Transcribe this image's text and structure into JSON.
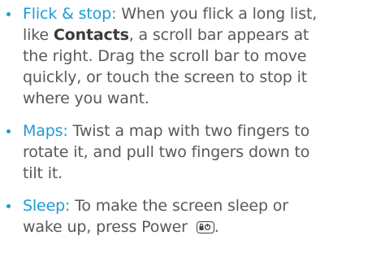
{
  "colors": {
    "accent": "#1e9ad6",
    "body_text": "#595959",
    "bold_text": "#3a3a3a"
  },
  "items": [
    {
      "term": "Flick & stop:",
      "line1_text": " When you flick a long list,",
      "line2_prefix": "like ",
      "line2_bold": "Contacts",
      "line2_suffix": ", a scroll bar appears at",
      "line3": "the right. Drag the scroll bar to move",
      "line4": "quickly, or touch the screen to stop it",
      "line5": "where you want."
    },
    {
      "term": "Maps:",
      "line1_text": " Twist a map with two fingers to",
      "line2": "rotate it, and pull two fingers down to",
      "line3": "tilt it."
    },
    {
      "term": "Sleep:",
      "line1_text": " To make the screen sleep or",
      "line2_prefix": "wake up, press Power ",
      "power_icon": "lock-power-icon",
      "line2_suffix": "."
    }
  ]
}
